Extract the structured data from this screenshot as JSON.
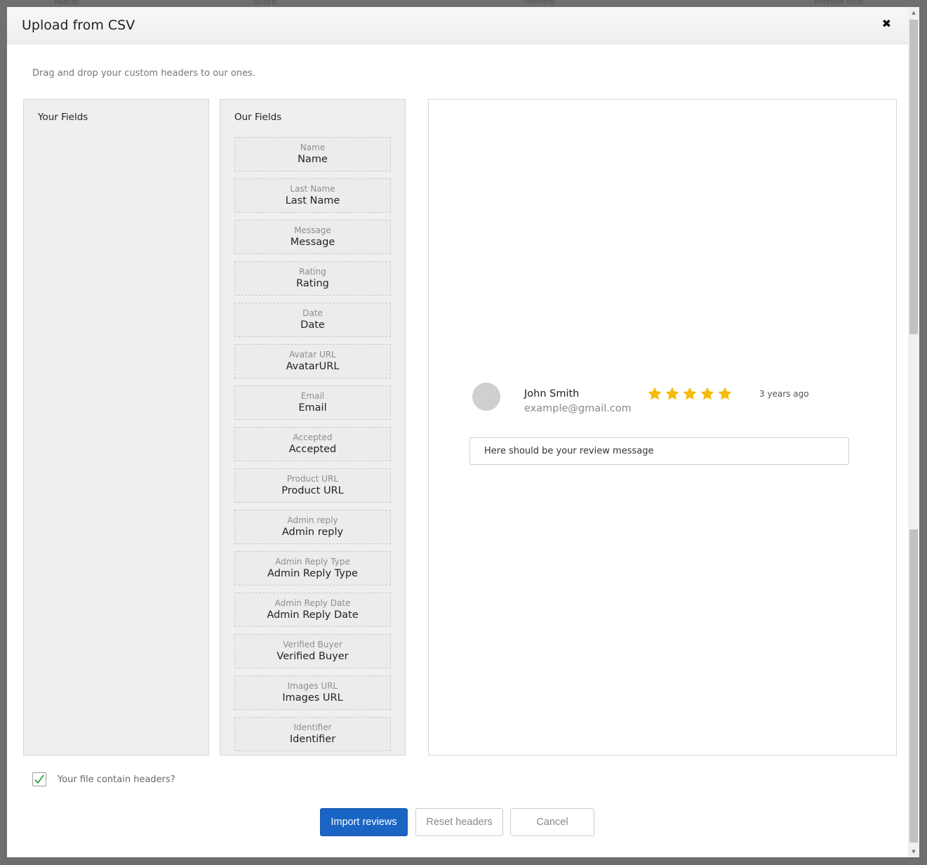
{
  "background": {
    "col_name": "Name",
    "col_score": "Score",
    "col_review": "Review",
    "col_review_time": "Review time"
  },
  "modal": {
    "title": "Upload from CSV",
    "close_icon": "close-icon",
    "hint": "Drag and drop your custom headers to our ones."
  },
  "your_fields": {
    "title": "Your Fields",
    "items": []
  },
  "our_fields": {
    "title": "Our Fields",
    "items": [
      {
        "sub": "Name",
        "main": "Name"
      },
      {
        "sub": "Last Name",
        "main": "Last Name"
      },
      {
        "sub": "Message",
        "main": "Message"
      },
      {
        "sub": "Rating",
        "main": "Rating"
      },
      {
        "sub": "Date",
        "main": "Date"
      },
      {
        "sub": "Avatar URL",
        "main": "AvatarURL"
      },
      {
        "sub": "Email",
        "main": "Email"
      },
      {
        "sub": "Accepted",
        "main": "Accepted"
      },
      {
        "sub": "Product URL",
        "main": "Product URL"
      },
      {
        "sub": "Admin reply",
        "main": "Admin reply"
      },
      {
        "sub": "Admin Reply Type",
        "main": "Admin Reply Type"
      },
      {
        "sub": "Admin Reply Date",
        "main": "Admin Reply Date"
      },
      {
        "sub": "Verified Buyer",
        "main": "Verified Buyer"
      },
      {
        "sub": "Images URL",
        "main": "Images URL"
      },
      {
        "sub": "Identifier",
        "main": "Identifier"
      }
    ]
  },
  "preview": {
    "name": "John Smith",
    "email": "example@gmail.com",
    "rating": 5,
    "rating_max": 5,
    "time": "3 years ago",
    "message": "Here should be your review message",
    "star_color": "#f5bb0c"
  },
  "options": {
    "headers_checkbox_label": "Your file contain headers?",
    "headers_checked": true
  },
  "buttons": {
    "import": "Import reviews",
    "reset": "Reset headers",
    "cancel": "Cancel"
  },
  "colors": {
    "primary": "#1a64c4"
  }
}
